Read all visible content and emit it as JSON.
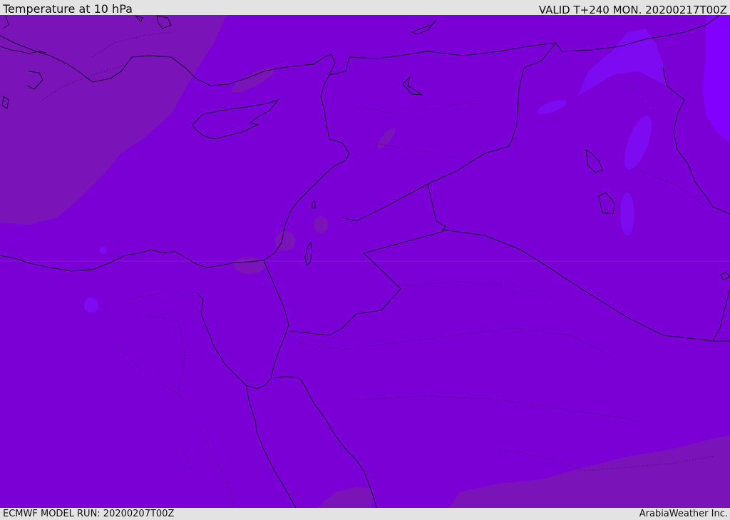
{
  "header": {
    "title": "Temperature at 10 hPa",
    "valid": "VALID T+240 MON. 20200217T00Z"
  },
  "footer": {
    "model_run": "ECMWF MODEL RUN: 20200207T00Z",
    "credit": "ArabiaWeather Inc."
  },
  "colors": {
    "base_fill": "#7a00d6",
    "warmer_fill": "#7a14b8",
    "cooler_fill": "#7d0af0",
    "coldest_fill": "#8200ff",
    "coastline": "#1a0033",
    "frame_bg": "#e3e3e3"
  }
}
